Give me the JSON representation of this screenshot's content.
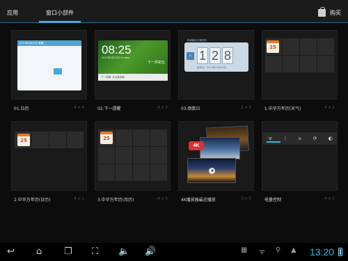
{
  "header": {
    "tabs": [
      {
        "label": "应用"
      },
      {
        "label": "窗口小部件"
      }
    ],
    "shop_label": "购买"
  },
  "widgets": [
    {
      "name": "01.日历",
      "size": "4 x 4"
    },
    {
      "name": "02.下一提醒",
      "size": "4 x 3"
    },
    {
      "name": "03.倒数日",
      "size": "2 x 2"
    },
    {
      "name": "1.中华万年历(天气)",
      "size": "4 x 2"
    },
    {
      "name": "2.中华万年历(日历)",
      "size": "4 x 1"
    },
    {
      "name": "3.中华万年历(月历)",
      "size": "4 x 3"
    },
    {
      "name": "4K播放器最近播放",
      "size": "3 x 3"
    },
    {
      "name": "电量控制",
      "size": "4 x 1"
    }
  ],
  "previews": {
    "calendar_header": "2012年6月19日 星期二",
    "reminder_time": "08:25",
    "reminder_date": "2012年6月19日 Sunday",
    "reminder_lunar": "十一月初五",
    "reminder_bar": "下一提醒: 未设置提醒",
    "countdown_title": "距离最后日期还有",
    "countdown_digits": [
      "1",
      "2",
      "8"
    ],
    "countdown_tag": "天",
    "countdown_footer": "目标日 : 2012年03月25日",
    "almanac_icon_day": "25",
    "badge_4k": "4K"
  },
  "status_bar": {
    "time": "13:20"
  },
  "icons": {
    "back": "back-icon",
    "home": "home-icon",
    "recent": "recent-apps-icon",
    "screenshot": "screenshot-icon",
    "volume_down": "volume-down-icon",
    "volume_up": "volume-up-icon"
  },
  "colors": {
    "accent": "#33b5e5",
    "background": "#0c0c0c",
    "tile": "#1a1a1a"
  }
}
